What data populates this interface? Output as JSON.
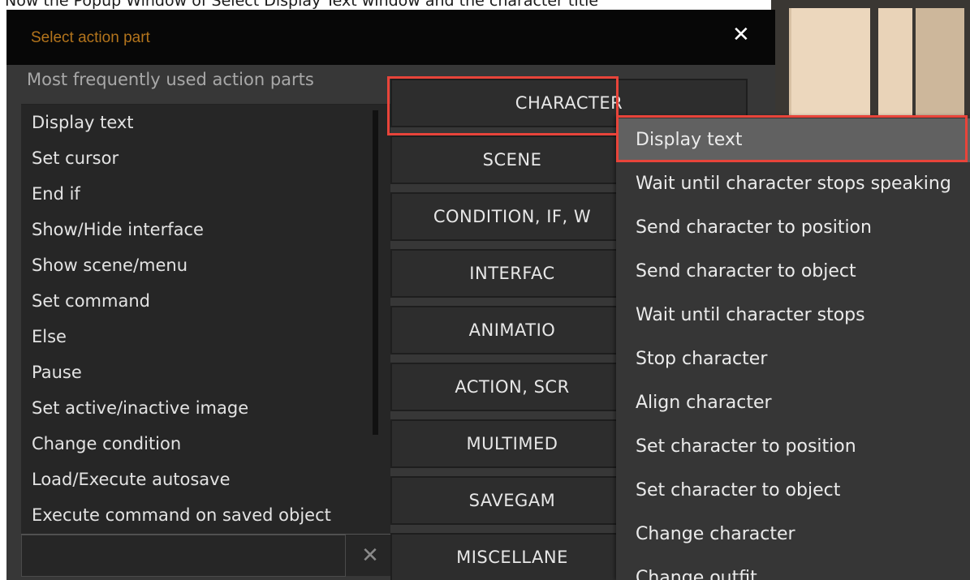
{
  "background": {
    "clipped_text": "Now the Popup Window of Select Display Text window and the character title"
  },
  "dialog": {
    "title": "Select action part",
    "close_symbol": "✕",
    "frequent_label": "Most frequently used action parts",
    "frequent_items": [
      "Display text",
      "Set cursor",
      "End if",
      "Show/Hide interface",
      "Show scene/menu",
      "Set command",
      "Else",
      "Pause",
      "Set active/inactive image",
      "Change condition",
      "Load/Execute autosave",
      "Execute command on saved object"
    ],
    "search": {
      "value": "",
      "clear_symbol": "✕"
    },
    "categories": [
      "CHARACTER",
      "SCENE",
      "CONDITION, IF, W",
      "INTERFAC",
      "ANIMATIO",
      "ACTION, SCR",
      "MULTIMED",
      "SAVEGAM",
      "MISCELLANE"
    ]
  },
  "submenu": {
    "items": [
      "Display text",
      "Wait until character stops speaking",
      "Send character to position",
      "Send character to object",
      "Wait until character stops",
      "Stop character",
      "Align character",
      "Set character to position",
      "Set character to object",
      "Change character",
      "Change outfit"
    ],
    "selected_index": 0
  },
  "colors": {
    "highlight": "#e8443a",
    "title_accent": "#b3741c",
    "dialog_bg": "#373737"
  }
}
